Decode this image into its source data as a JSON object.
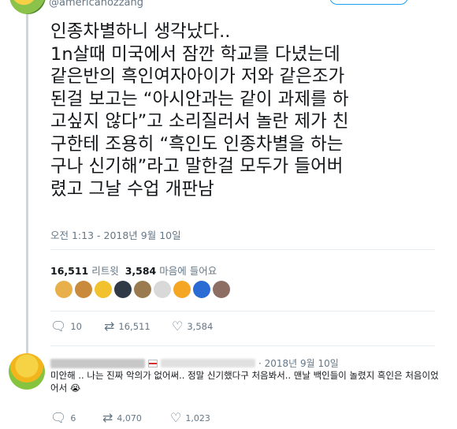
{
  "header": {
    "handle": "@americanozzang"
  },
  "tweet": {
    "text": "인종차별하니 생각났다..\n1n살때 미국에서 잠깐 학교를 다녔는데\n같은반의 흑인여자아이가 저와 같은조가\n된걸 보고는 “아시안과는 같이 과제를 하\n고싶지 않다”고 소리질러서 놀란 제가 친\n구한테 조용히 “흑인도 인종차별을 하는\n구나 신기해”라고 말한걸 모두가 들어버\n렸고 그날 수업 개판남",
    "timestamp": "오전 1:13 - 2018년 9월 10일",
    "retweets": "16,511",
    "retweets_label": "리트윗",
    "likes": "3,584",
    "likes_label": "마음에 들어요",
    "likers": [
      "#e8b04a",
      "#c98a3b",
      "#f2c22e",
      "#2f3a46",
      "#9a7b4f",
      "#d9d9d9",
      "#f5a623",
      "#2b6cd4",
      "#8d6e63"
    ],
    "action_counts": {
      "reply": "10",
      "retweet": "16,511",
      "like": "3,584"
    }
  },
  "reply": {
    "date": "· 2018년 9월 10일",
    "text": "미안해 .. 나는 진짜 악의가 없어써.. 정말 신기했다구 처음봐서.. 맨날 백인들이 놀렸지 흑인은 처음이었어서 😭",
    "action_counts": {
      "reply": "6",
      "retweet": "4,070",
      "like": "1,023"
    }
  }
}
